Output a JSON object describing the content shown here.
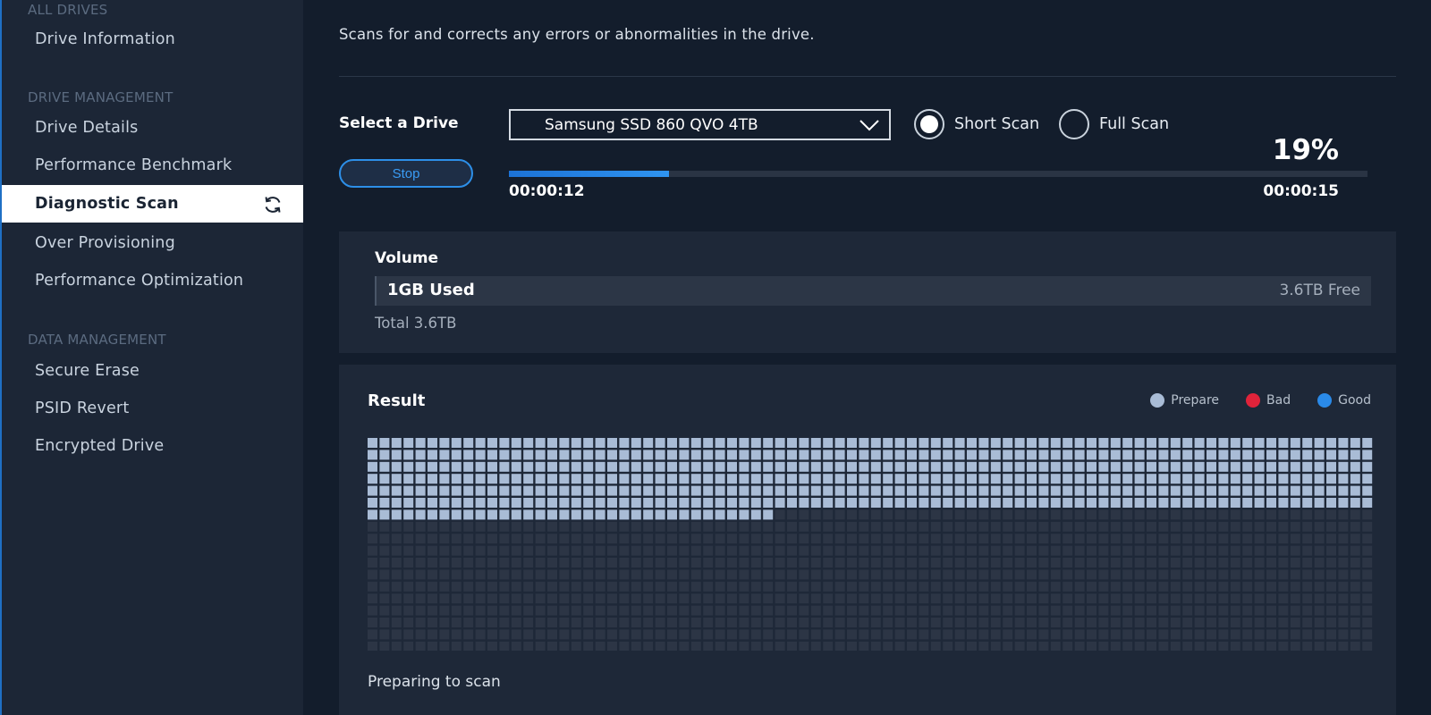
{
  "sidebar": {
    "section_all": "ALL DRIVES",
    "section_drive_mgmt": "DRIVE MANAGEMENT",
    "section_data_mgmt": "DATA MANAGEMENT",
    "items": [
      {
        "label": "Drive Information"
      },
      {
        "label": "Drive Details"
      },
      {
        "label": "Performance Benchmark"
      },
      {
        "label": "Diagnostic Scan",
        "active": true
      },
      {
        "label": "Over Provisioning"
      },
      {
        "label": "Performance Optimization"
      },
      {
        "label": "Secure Erase"
      },
      {
        "label": "PSID Revert"
      },
      {
        "label": "Encrypted Drive"
      }
    ],
    "active_icon": "sync-icon"
  },
  "main": {
    "subtitle": "Scans for and corrects any errors or abnormalities in the drive.",
    "select_label": "Select a Drive",
    "selected_drive": "Samsung SSD 860 QVO 4TB",
    "scan_options": [
      {
        "label": "Short Scan",
        "selected": true
      },
      {
        "label": "Full Scan",
        "selected": false
      }
    ],
    "stop_label": "Stop",
    "progress_percent_text": "19%",
    "progress_fraction": 0.186,
    "elapsed": "00:00:12",
    "remaining": "00:00:15"
  },
  "volume": {
    "title": "Volume",
    "used": "1GB Used",
    "free": "3.6TB Free",
    "total": "Total 3.6TB"
  },
  "result": {
    "title": "Result",
    "legend": [
      {
        "label": "Prepare",
        "color": "#a9bcd6"
      },
      {
        "label": "Bad",
        "color": "#e0233a"
      },
      {
        "label": "Good",
        "color": "#2a8ae8"
      }
    ],
    "status": "Preparing to scan",
    "blocks": {
      "columns": 84,
      "rows": 18,
      "prepared_full_rows": 6,
      "prepared_partial_row_count": 34,
      "prepare_color": "#a9bcd6",
      "pending_color": "#2c3545"
    }
  },
  "colors": {
    "accent": "#2d8fe8",
    "background": "#131d2c",
    "sidebar": "#1c2636",
    "panel": "#1e2838"
  }
}
